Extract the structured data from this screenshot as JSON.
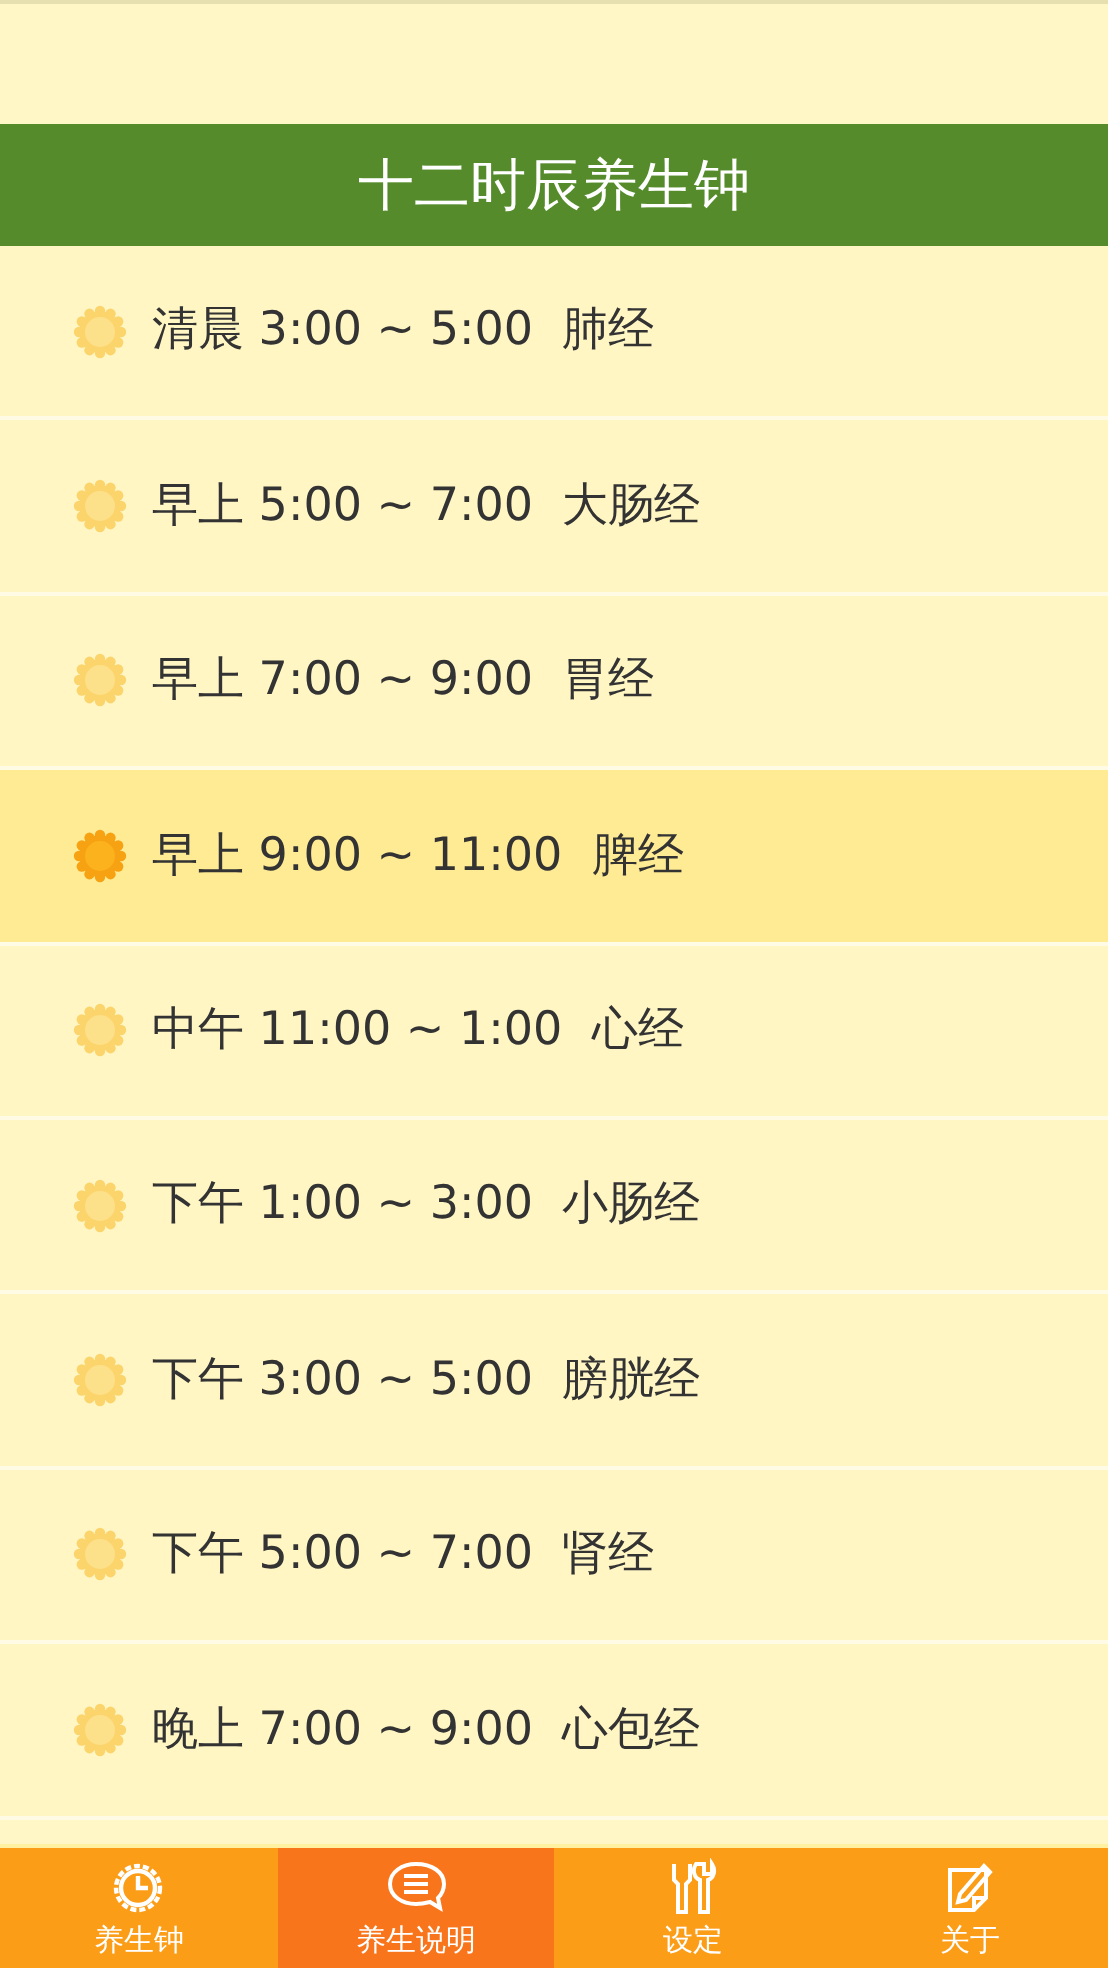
{
  "header": {
    "title": "十二时辰养生钟"
  },
  "rows": [
    {
      "text": "清晨 3:00 ~ 5:00  肺经",
      "selected": false
    },
    {
      "text": "早上 5:00 ~ 7:00  大肠经",
      "selected": false
    },
    {
      "text": "早上 7:00 ~ 9:00  胃经",
      "selected": false
    },
    {
      "text": "早上 9:00 ~ 11:00  脾经",
      "selected": true
    },
    {
      "text": "中午 11:00 ~ 1:00  心经",
      "selected": false
    },
    {
      "text": "下午 1:00 ~ 3:00  小肠经",
      "selected": false
    },
    {
      "text": "下午 3:00 ~ 5:00  膀胱经",
      "selected": false
    },
    {
      "text": "下午 5:00 ~ 7:00  肾经",
      "selected": false
    },
    {
      "text": "晚上 7:00 ~ 9:00  心包经",
      "selected": false
    }
  ],
  "tabs": [
    {
      "label": "养生钟",
      "kind": "clock",
      "selected": false
    },
    {
      "label": "养生说明",
      "kind": "chat",
      "selected": true
    },
    {
      "label": "设定",
      "kind": "tools",
      "selected": false
    },
    {
      "label": "关于",
      "kind": "note",
      "selected": false
    }
  ]
}
